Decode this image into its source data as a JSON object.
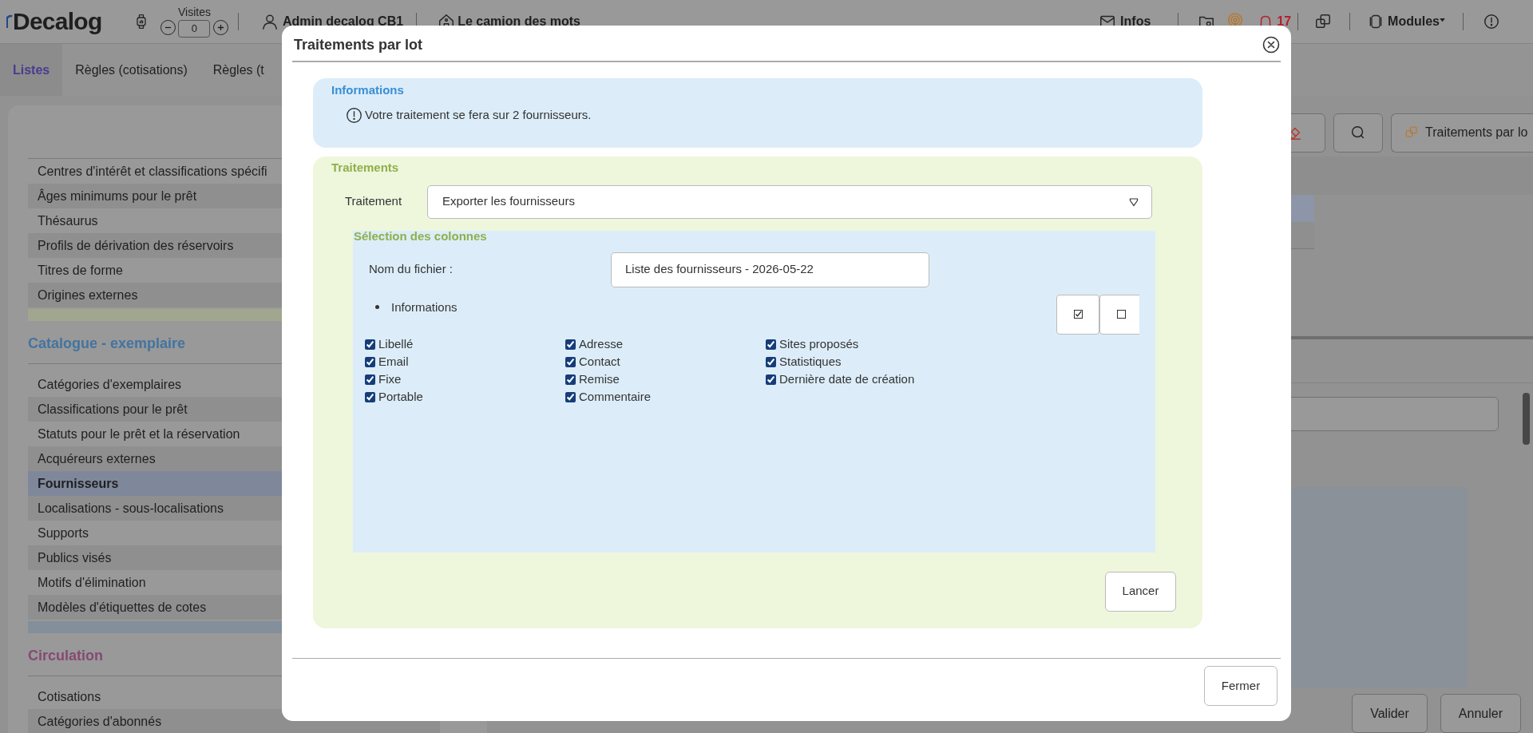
{
  "top_bar": {
    "logo": "Decalog",
    "visits_label": "Visites",
    "visits_value": "0",
    "user": "Admin decalog CB1",
    "site": "Le camion des mots",
    "infos": "Infos",
    "notifications": "17",
    "modules": "Modules"
  },
  "tabs": [
    {
      "label": "Listes",
      "selected": true
    },
    {
      "label": "Règles (cotisations)",
      "selected": false
    },
    {
      "label": "Règles (t",
      "selected": false
    }
  ],
  "sidebar": {
    "sections": [
      {
        "color": "#a1a78e",
        "items": [
          {
            "label": "Centres d'intérêt et classifications spécifi",
            "selected": false
          },
          {
            "label": "Âges minimums pour le prêt",
            "selected": false
          },
          {
            "label": "Thésaurus",
            "selected": false
          },
          {
            "label": "Profils de dérivation des réservoirs",
            "selected": false
          },
          {
            "label": "Titres de forme",
            "selected": false
          },
          {
            "label": "Origines externes",
            "selected": false
          }
        ]
      },
      {
        "title": "Catalogue - exemplaire",
        "color": "#43749f",
        "items": [
          {
            "label": "Catégories d'exemplaires",
            "selected": false
          },
          {
            "label": "Classifications pour le prêt",
            "selected": false
          },
          {
            "label": "Statuts pour le prêt et la réservation",
            "selected": false
          },
          {
            "label": "Acquéreurs externes",
            "selected": false
          },
          {
            "label": "Fournisseurs",
            "selected": true
          },
          {
            "label": "Localisations - sous-localisations",
            "selected": false
          },
          {
            "label": "Supports",
            "selected": false
          },
          {
            "label": "Publics visés",
            "selected": false
          },
          {
            "label": "Motifs d'élimination",
            "selected": false
          },
          {
            "label": "Modèles d'étiquettes de cotes",
            "selected": false
          }
        ]
      },
      {
        "title": "Circulation",
        "color": "#864a72",
        "items": [
          {
            "label": "Cotisations",
            "selected": false
          },
          {
            "label": "Catégories d'abonnés",
            "selected": false
          }
        ]
      }
    ]
  },
  "toolbar": {
    "batch_button": "Traitements par lo"
  },
  "footer_buttons": [
    "Valider",
    "Annuler"
  ],
  "dialog": {
    "title": "Traitements par lot",
    "info_panel": {
      "title": "Informations",
      "message": "Votre traitement se fera sur 2 fournisseurs."
    },
    "treatment_panel": {
      "title": "Traitements",
      "field_label": "Traitement",
      "field_value": "Exporter les fournisseurs",
      "columns_panel": {
        "title": "Sélection des colonnes",
        "filename_label": "Nom du fichier :",
        "filename_value": "Liste des fournisseurs - 2026-05-22",
        "group": "Informations",
        "columns": [
          [
            {
              "label": "Libellé",
              "checked": true
            },
            {
              "label": "Email",
              "checked": true
            },
            {
              "label": "Fixe",
              "checked": true
            },
            {
              "label": "Portable",
              "checked": true
            }
          ],
          [
            {
              "label": "Adresse",
              "checked": true
            },
            {
              "label": "Contact",
              "checked": true
            },
            {
              "label": "Remise",
              "checked": true
            },
            {
              "label": "Commentaire",
              "checked": true
            }
          ],
          [
            {
              "label": "Sites proposés",
              "checked": true
            },
            {
              "label": "Statistiques",
              "checked": true
            },
            {
              "label": "Dernière date de création",
              "checked": true
            }
          ]
        ]
      },
      "run_button": "Lancer"
    },
    "close_button": "Fermer"
  }
}
